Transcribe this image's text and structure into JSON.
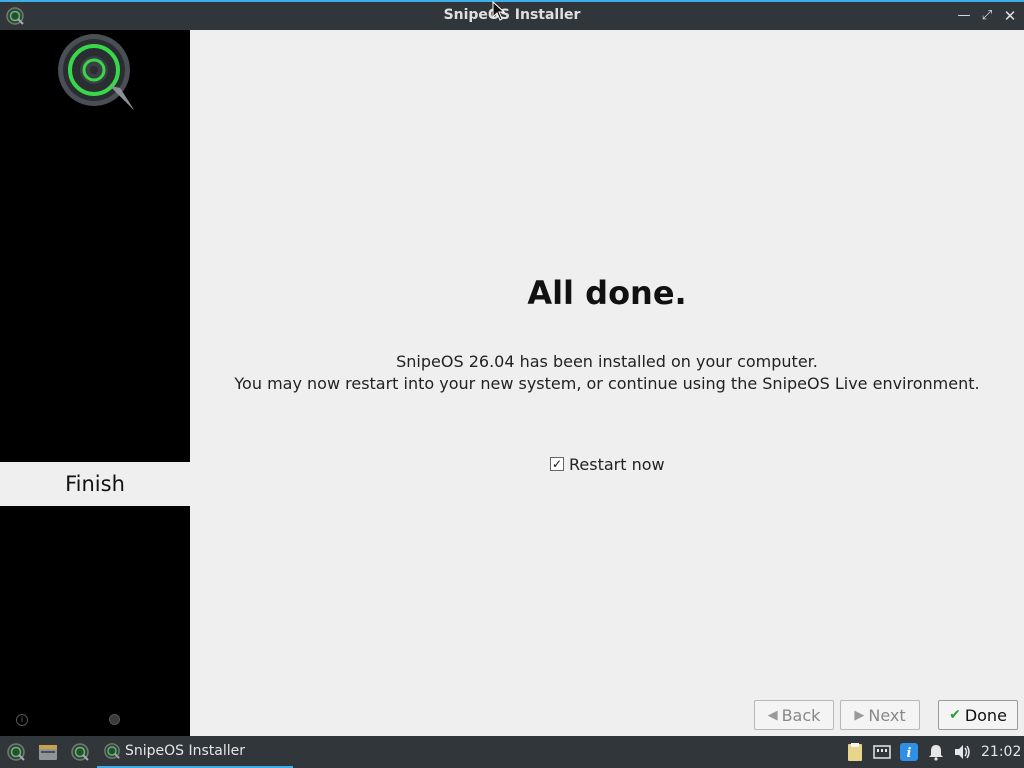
{
  "window": {
    "title": "SnipeOS Installer"
  },
  "sidebar": {
    "steps": [
      {
        "label": "Finish",
        "active": true
      }
    ]
  },
  "main": {
    "heading": "All done.",
    "message_line1": "SnipeOS 26.04 has been installed on your computer.",
    "message_line2": "You may now restart into your new system, or continue using the SnipeOS Live environment.",
    "restart_checkbox": {
      "label": "Restart now",
      "checked": true
    }
  },
  "buttons": {
    "back": "Back",
    "next": "Next",
    "done": "Done"
  },
  "taskbar": {
    "task_label": "SnipeOS Installer",
    "clock": "21:02"
  },
  "colors": {
    "accent": "#3daee9",
    "titlebar": "#31363b",
    "logo_green": "#38d84a"
  },
  "icons": [
    "app-logo-icon",
    "minimize-icon",
    "maximize-icon",
    "close-icon",
    "arrow-left-icon",
    "arrow-right-icon",
    "check-icon",
    "file-manager-icon",
    "clipboard-icon",
    "network-icon",
    "info-icon",
    "bell-icon",
    "volume-icon"
  ]
}
